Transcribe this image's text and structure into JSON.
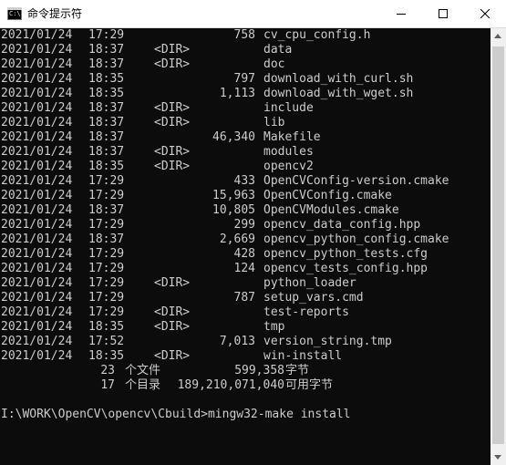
{
  "window": {
    "title": "命令提示符",
    "icon_text": "C:\\",
    "accent": "#0c0c0c",
    "text_color": "#cccccc"
  },
  "controls": {
    "minimize": "minimize-icon",
    "maximize": "maximize-icon",
    "close": "close-icon"
  },
  "listing": [
    {
      "date": "2021/01/24",
      "time": "17:29",
      "dir": "",
      "size": "758",
      "name": "cv_cpu_config.h"
    },
    {
      "date": "2021/01/24",
      "time": "18:37",
      "dir": "<DIR>",
      "size": "",
      "name": "data"
    },
    {
      "date": "2021/01/24",
      "time": "18:37",
      "dir": "<DIR>",
      "size": "",
      "name": "doc"
    },
    {
      "date": "2021/01/24",
      "time": "18:35",
      "dir": "",
      "size": "797",
      "name": "download_with_curl.sh"
    },
    {
      "date": "2021/01/24",
      "time": "18:35",
      "dir": "",
      "size": "1,113",
      "name": "download_with_wget.sh"
    },
    {
      "date": "2021/01/24",
      "time": "18:37",
      "dir": "<DIR>",
      "size": "",
      "name": "include"
    },
    {
      "date": "2021/01/24",
      "time": "18:37",
      "dir": "<DIR>",
      "size": "",
      "name": "lib"
    },
    {
      "date": "2021/01/24",
      "time": "18:37",
      "dir": "",
      "size": "46,340",
      "name": "Makefile"
    },
    {
      "date": "2021/01/24",
      "time": "18:37",
      "dir": "<DIR>",
      "size": "",
      "name": "modules"
    },
    {
      "date": "2021/01/24",
      "time": "18:35",
      "dir": "<DIR>",
      "size": "",
      "name": "opencv2"
    },
    {
      "date": "2021/01/24",
      "time": "17:29",
      "dir": "",
      "size": "433",
      "name": "OpenCVConfig-version.cmake"
    },
    {
      "date": "2021/01/24",
      "time": "17:29",
      "dir": "",
      "size": "15,963",
      "name": "OpenCVConfig.cmake"
    },
    {
      "date": "2021/01/24",
      "time": "18:37",
      "dir": "",
      "size": "10,805",
      "name": "OpenCVModules.cmake"
    },
    {
      "date": "2021/01/24",
      "time": "17:29",
      "dir": "",
      "size": "299",
      "name": "opencv_data_config.hpp"
    },
    {
      "date": "2021/01/24",
      "time": "18:37",
      "dir": "",
      "size": "2,669",
      "name": "opencv_python_config.cmake"
    },
    {
      "date": "2021/01/24",
      "time": "17:29",
      "dir": "",
      "size": "428",
      "name": "opencv_python_tests.cfg"
    },
    {
      "date": "2021/01/24",
      "time": "17:29",
      "dir": "",
      "size": "124",
      "name": "opencv_tests_config.hpp"
    },
    {
      "date": "2021/01/24",
      "time": "17:29",
      "dir": "<DIR>",
      "size": "",
      "name": "python_loader"
    },
    {
      "date": "2021/01/24",
      "time": "17:29",
      "dir": "",
      "size": "787",
      "name": "setup_vars.cmd"
    },
    {
      "date": "2021/01/24",
      "time": "17:29",
      "dir": "<DIR>",
      "size": "",
      "name": "test-reports"
    },
    {
      "date": "2021/01/24",
      "time": "18:35",
      "dir": "<DIR>",
      "size": "",
      "name": "tmp"
    },
    {
      "date": "2021/01/24",
      "time": "17:52",
      "dir": "",
      "size": "7,013",
      "name": "version_string.tmp"
    },
    {
      "date": "2021/01/24",
      "time": "18:35",
      "dir": "<DIR>",
      "size": "",
      "name": "win-install"
    }
  ],
  "summary": {
    "files": {
      "count": "23",
      "label": "个文件",
      "size": "599,358",
      "unit": "字节"
    },
    "dirs": {
      "count": "17",
      "label": "个目录",
      "size": "189,210,071,040",
      "unit": "可用字节"
    }
  },
  "prompt": {
    "text": "I:\\WORK\\OpenCV\\opencv\\Cbuild>mingw32-make install"
  }
}
